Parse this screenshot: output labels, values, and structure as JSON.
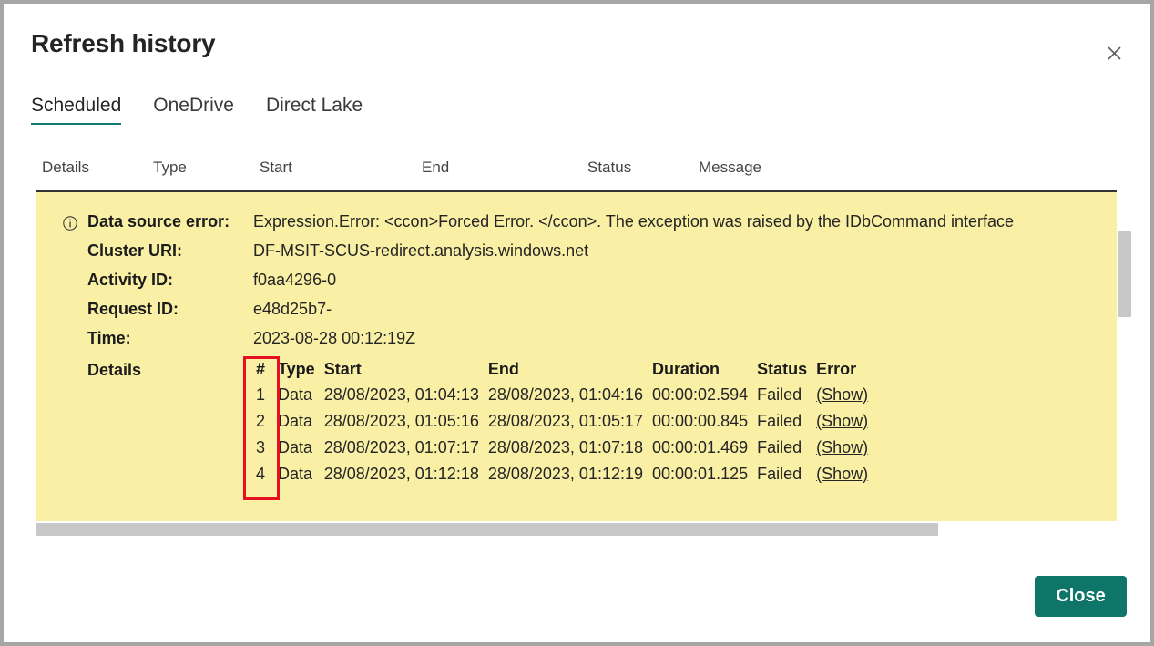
{
  "dialog": {
    "title": "Refresh history",
    "close_icon": "close-icon",
    "close_button_label": "Close"
  },
  "tabs": [
    {
      "label": "Scheduled",
      "active": true
    },
    {
      "label": "OneDrive",
      "active": false
    },
    {
      "label": "Direct Lake",
      "active": false
    }
  ],
  "grid_columns": {
    "details": "Details",
    "type": "Type",
    "start": "Start",
    "end": "End",
    "status": "Status",
    "message": "Message"
  },
  "error_panel": {
    "info_icon": "info-circle-icon",
    "background_color": "#faf0a5",
    "fields": [
      {
        "label": "Data source error:",
        "value": "Expression.Error: <ccon>Forced Error. </ccon>. The exception was raised by the IDbCommand interface"
      },
      {
        "label": "Cluster URI:",
        "value": "DF-MSIT-SCUS-redirect.analysis.windows.net"
      },
      {
        "label": "Activity ID:",
        "value": "f0aa4296-0"
      },
      {
        "label": "Request ID:",
        "value": "e48d25b7-"
      },
      {
        "label": "Time:",
        "value": "2023-08-28 00:12:19Z"
      }
    ],
    "details_label": "Details",
    "details_table": {
      "columns": [
        "#",
        "Type",
        "Start",
        "End",
        "Duration",
        "Status",
        "Error"
      ],
      "rows": [
        {
          "num": "1",
          "type": "Data",
          "start": "28/08/2023, 01:04:13",
          "end": "28/08/2023, 01:04:16",
          "duration": "00:00:02.594",
          "status": "Failed",
          "error": "(Show)"
        },
        {
          "num": "2",
          "type": "Data",
          "start": "28/08/2023, 01:05:16",
          "end": "28/08/2023, 01:05:17",
          "duration": "00:00:00.845",
          "status": "Failed",
          "error": "(Show)"
        },
        {
          "num": "3",
          "type": "Data",
          "start": "28/08/2023, 01:07:17",
          "end": "28/08/2023, 01:07:18",
          "duration": "00:00:01.469",
          "status": "Failed",
          "error": "(Show)"
        },
        {
          "num": "4",
          "type": "Data",
          "start": "28/08/2023, 01:12:18",
          "end": "28/08/2023, 01:12:19",
          "duration": "00:00:01.125",
          "status": "Failed",
          "error": "(Show)"
        }
      ]
    }
  },
  "highlight": {
    "target": "number-column",
    "color": "#e81123"
  },
  "accent_color": "#107569"
}
